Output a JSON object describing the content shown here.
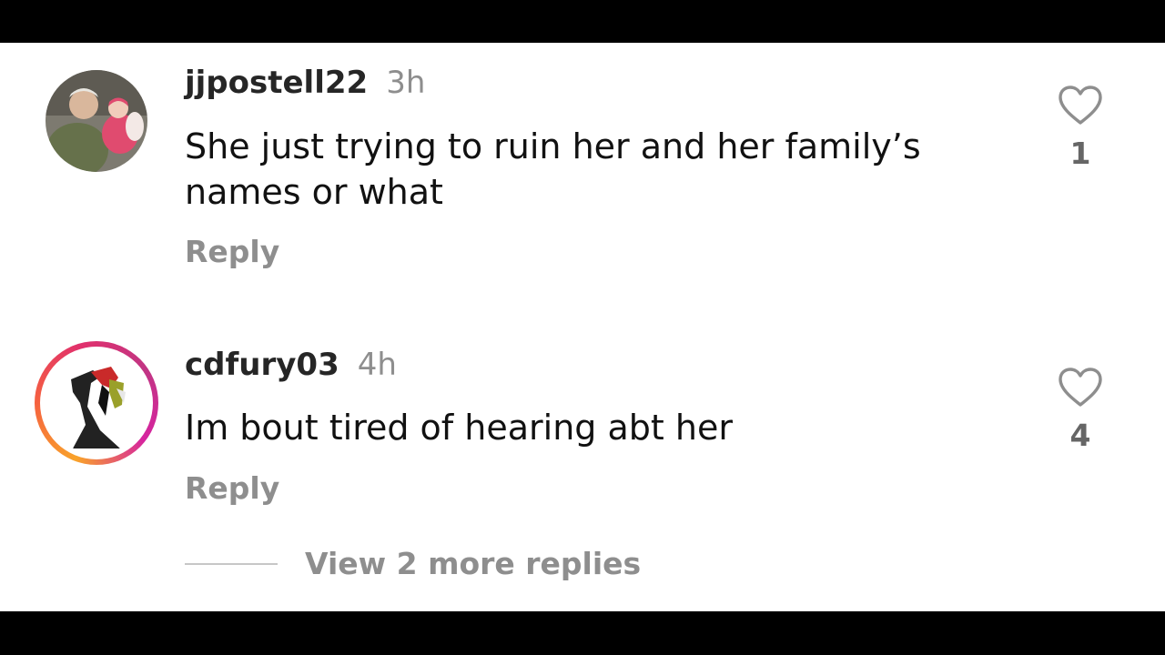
{
  "comments": [
    {
      "username": "jjpostell22",
      "time": "3h",
      "text": "She just trying to ruin her and her family’s names or what",
      "reply_label": "Reply",
      "like_count": "1",
      "avatar": "photo-avatar"
    },
    {
      "username": "cdfury03",
      "time": "4h",
      "text": "Im bout tired of hearing abt her",
      "reply_label": "Reply",
      "like_count": "4",
      "avatar": "story-ring-avatar"
    }
  ],
  "view_more_label": "View 2 more replies",
  "icons": {
    "like": "heart-outline-icon"
  },
  "colors": {
    "username": "#262626",
    "secondary": "#8e8e8e",
    "story_ring": [
      "#f9a32a",
      "#e1306c",
      "#c13584"
    ]
  }
}
